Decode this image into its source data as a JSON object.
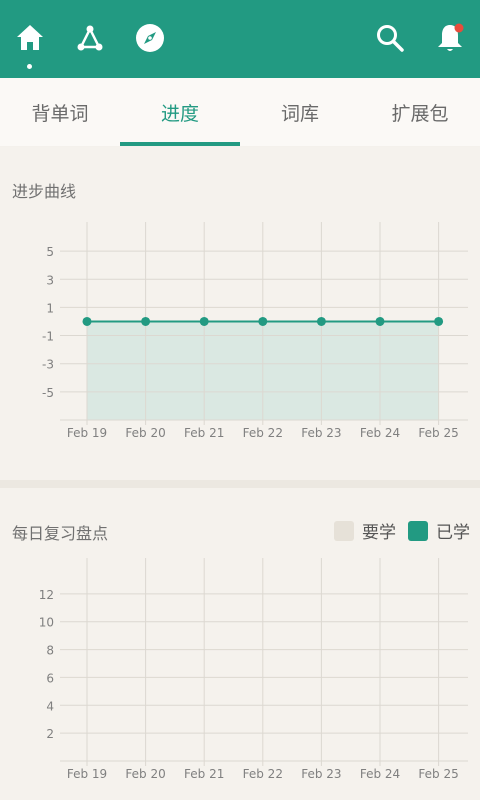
{
  "icons": {
    "home": "home-icon",
    "network": "network-icon",
    "compass": "compass-icon",
    "search": "search-icon",
    "bell": "bell-icon"
  },
  "colors": {
    "primary": "#229a82",
    "accent_badge": "#e74c3c",
    "area_fill": "#d5e6df",
    "legend_todo": "#e6e1d8"
  },
  "tabs": [
    {
      "label": "背单词"
    },
    {
      "label": "进度"
    },
    {
      "label": "词库"
    },
    {
      "label": "扩展包"
    }
  ],
  "active_tab": "进度",
  "progress_card": {
    "title": "进步曲线"
  },
  "review_card": {
    "title": "每日复习盘点",
    "legend": [
      {
        "label": "要学"
      },
      {
        "label": "已学"
      }
    ]
  },
  "chart_data": [
    {
      "type": "area",
      "title": "进步曲线",
      "categories": [
        "Feb 19",
        "Feb 20",
        "Feb 21",
        "Feb 22",
        "Feb 23",
        "Feb 24",
        "Feb 25"
      ],
      "yticks": [
        5,
        3,
        1,
        -1,
        -3,
        -5
      ],
      "ylim": [
        -7,
        6.5
      ],
      "series": [
        {
          "values": [
            0,
            0,
            0,
            0,
            0,
            0,
            0
          ]
        }
      ],
      "grid": true
    },
    {
      "type": "bar",
      "title": "每日复习盘点",
      "categories": [
        "Feb 19",
        "Feb 20",
        "Feb 21",
        "Feb 22",
        "Feb 23",
        "Feb 24",
        "Feb 25"
      ],
      "yticks": [
        12,
        10,
        8,
        6,
        4,
        2
      ],
      "ylim": [
        0,
        14
      ],
      "series": [
        {
          "name": "要学",
          "values": [
            0,
            0,
            0,
            0,
            0,
            0,
            0
          ]
        },
        {
          "name": "已学",
          "values": [
            0,
            0,
            0,
            0,
            0,
            0,
            0
          ]
        }
      ],
      "legend": "top-right",
      "grid": true
    }
  ]
}
